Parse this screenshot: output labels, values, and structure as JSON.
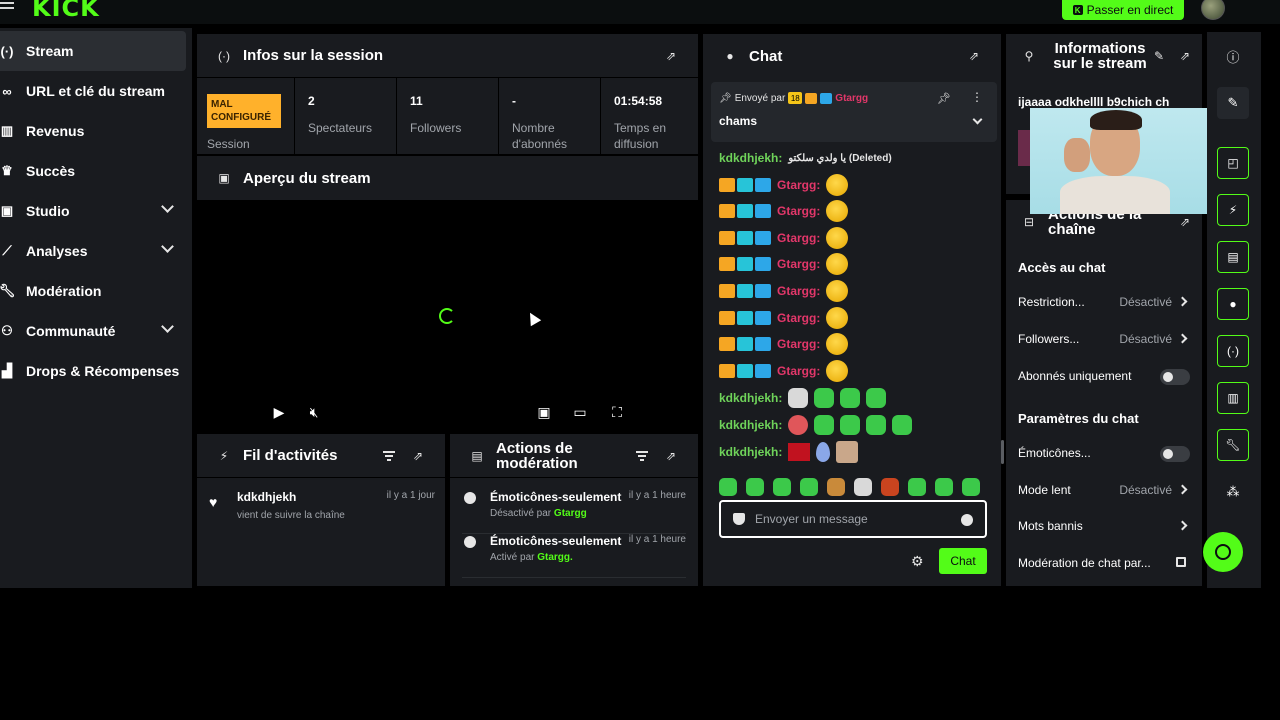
{
  "app": {
    "logo_text": "KICK",
    "go_live_label": "Passer en direct",
    "accent_color": "#53fc18"
  },
  "sidebar": {
    "items": [
      {
        "label": "Stream",
        "icon": "broadcast-icon",
        "active": true
      },
      {
        "label": "URL et clé du stream",
        "icon": "link-icon"
      },
      {
        "label": "Revenus",
        "icon": "chart-icon"
      },
      {
        "label": "Succès",
        "icon": "trophy-icon"
      },
      {
        "label": "Studio",
        "icon": "studio-icon",
        "expandable": true
      },
      {
        "label": "Analyses",
        "icon": "analytics-icon",
        "expandable": true
      },
      {
        "label": "Modération",
        "icon": "wrench-icon"
      },
      {
        "label": "Communauté",
        "icon": "people-icon",
        "expandable": true
      },
      {
        "label": "Drops & Récompenses",
        "icon": "drops-icon"
      }
    ]
  },
  "session": {
    "title": "Infos sur la session",
    "status_badge": "MAL CONFIGURÉ",
    "status_label": "Session",
    "stats": [
      {
        "value": "2",
        "label": "Spectateurs"
      },
      {
        "value": "11",
        "label": "Followers"
      },
      {
        "value": "-",
        "label": "Nombre d'abonnés"
      },
      {
        "value": "01:54:58",
        "label": "Temps en diffusion"
      }
    ]
  },
  "preview": {
    "title": "Aperçu du stream"
  },
  "activity": {
    "title": "Fil d'activités",
    "items": [
      {
        "name": "kdkdhjekh",
        "text": "vient de suivre la chaîne",
        "time": "il y a 1 jour"
      }
    ]
  },
  "mod_actions": {
    "title": "Actions de modération",
    "items": [
      {
        "title": "Émoticônes-seulement",
        "status": "Désactivé par",
        "user": "Gtargg",
        "time": "il y a 1 heure"
      },
      {
        "title": "Émoticônes-seulement",
        "status": "Activé par",
        "user": "Gtargg.",
        "time": "il y a 1 heure"
      }
    ]
  },
  "chat": {
    "title": "Chat",
    "pinned": {
      "prefix": "Envoyé par",
      "user": "Gtargg",
      "message": "chams"
    },
    "messages": [
      {
        "user": "kdkdhjekh:",
        "text": "يا ولدي سلكتو (Deleted)"
      },
      {
        "user": "Gtargg:"
      },
      {
        "user": "Gtargg:"
      },
      {
        "user": "Gtargg:"
      },
      {
        "user": "Gtargg:"
      },
      {
        "user": "Gtargg:"
      },
      {
        "user": "Gtargg:"
      },
      {
        "user": "Gtargg:"
      },
      {
        "user": "Gtargg:"
      },
      {
        "user": "kdkdhjekh:"
      },
      {
        "user": "kdkdhjekh:"
      },
      {
        "user": "kdkdhjekh:"
      }
    ],
    "input_placeholder": "Envoyer un message",
    "send_label": "Chat"
  },
  "stream_info": {
    "title": "Informations sur le stream",
    "text": "ijaaaa odkhellll b9chich ch"
  },
  "channel_actions": {
    "title": "Actions de la chaîne",
    "chat_access_title": "Accès au chat",
    "rows_access": [
      {
        "label": "Restriction...",
        "value": "Désactivé"
      },
      {
        "label": "Followers...",
        "value": "Désactivé"
      },
      {
        "label": "Abonnés uniquement",
        "toggle": false
      }
    ],
    "chat_settings_title": "Paramètres du chat",
    "rows_settings": [
      {
        "label": "Émoticônes...",
        "toggle": false
      },
      {
        "label": "Mode lent",
        "value": "Désactivé"
      },
      {
        "label": "Mots bannis"
      },
      {
        "label": "Modération de chat par..."
      }
    ]
  }
}
